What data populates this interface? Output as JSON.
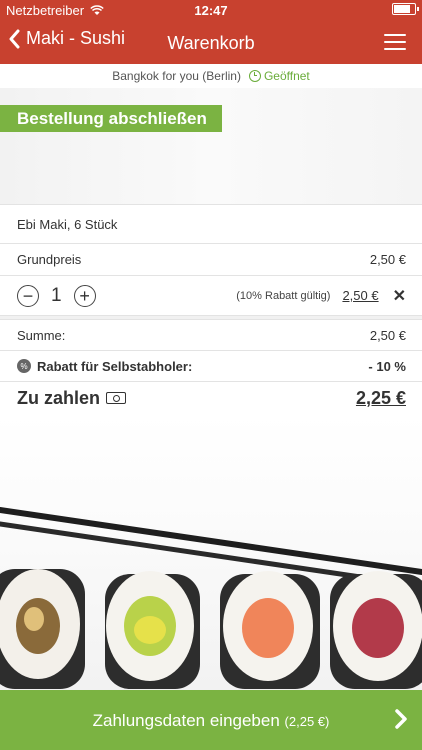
{
  "status_bar": {
    "carrier": "Netzbetreiber",
    "time": "12:47",
    "battery_level": 0.9
  },
  "nav": {
    "back_label": "Maki - Sushi",
    "title": "Warenkorb"
  },
  "restaurant": {
    "name": "Bangkok for you (Berlin)",
    "status": "Geöffnet"
  },
  "checkout_button": "Bestellung abschließen",
  "cart": {
    "item_name": "Ebi Maki, 6 Stück",
    "base_price_label": "Grundpreis",
    "base_price": "2,50 €",
    "quantity": "1",
    "decrement": "−",
    "increment": "+",
    "discount_note": "(10% Rabatt gültig)",
    "item_price": "2,50 €",
    "remove": "✕"
  },
  "summary": {
    "sum_label": "Summe:",
    "sum_value": "2,50 €",
    "discount_badge": "%",
    "discount_label": "Rabatt für Selbstabholer:",
    "discount_value": "- 10 %",
    "total_label": "Zu zahlen",
    "total_value": "2,25 €"
  },
  "pay_button": {
    "label": "Zahlungsdaten eingeben",
    "amount": "(2,25 €)"
  },
  "colors": {
    "header": "#c8412f",
    "accent_green": "#7bb342",
    "open_green": "#6aac3a"
  }
}
